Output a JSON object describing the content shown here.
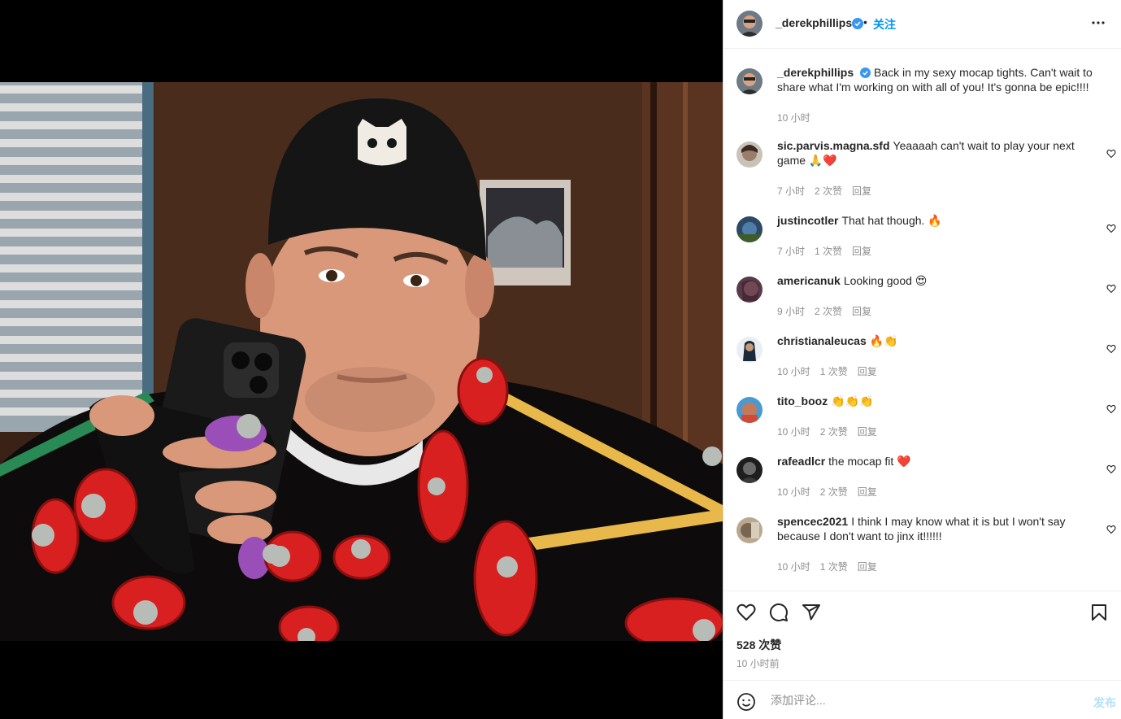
{
  "post": {
    "author": "_derekphillips",
    "follow_label": "关注",
    "dot": "•",
    "caption_author": "_derekphillips",
    "caption": "Back in my sexy mocap tights. Can't wait to share what I'm working on with all of you! It's gonna be epic!!!!",
    "caption_time": "10 小时",
    "likes": "528 次赞",
    "posted": "10 小时前",
    "verified_color": "#3897f0",
    "accent": "#0095f6"
  },
  "comments": [
    {
      "user": "sic.parvis.magna.sfd",
      "text": "Yeaaaah can't wait to play your next game 🙏❤️",
      "time": "7 小时",
      "likes": "2 次赞",
      "reply": "回复"
    },
    {
      "user": "justincotler",
      "text": "That hat though. 🔥",
      "time": "7 小时",
      "likes": "1 次赞",
      "reply": "回复"
    },
    {
      "user": "americanuk",
      "text": "Looking good 😍",
      "time": "9 小时",
      "likes": "2 次赞",
      "reply": "回复"
    },
    {
      "user": "christianaleucas",
      "text": "🔥👏",
      "time": "10 小时",
      "likes": "1 次赞",
      "reply": "回复"
    },
    {
      "user": "tito_booz",
      "text": "👏👏👏",
      "time": "10 小时",
      "likes": "2 次赞",
      "reply": "回复"
    },
    {
      "user": "rafeadlcr",
      "text": "the mocap fit ❤️",
      "time": "10 小时",
      "likes": "2 次赞",
      "reply": "回复"
    },
    {
      "user": "spencec2021",
      "text": "I think I may know what it is but I won't say because I don't want to jinx it!!!!!!",
      "time": "10 小时",
      "likes": "1 次赞",
      "reply": "回复"
    }
  ],
  "composer": {
    "placeholder": "添加评论...",
    "post_label": "发布"
  },
  "icons": [
    "heart-icon",
    "comment-icon",
    "share-icon",
    "bookmark-icon",
    "more-icon",
    "emoji-icon",
    "verified-icon"
  ]
}
